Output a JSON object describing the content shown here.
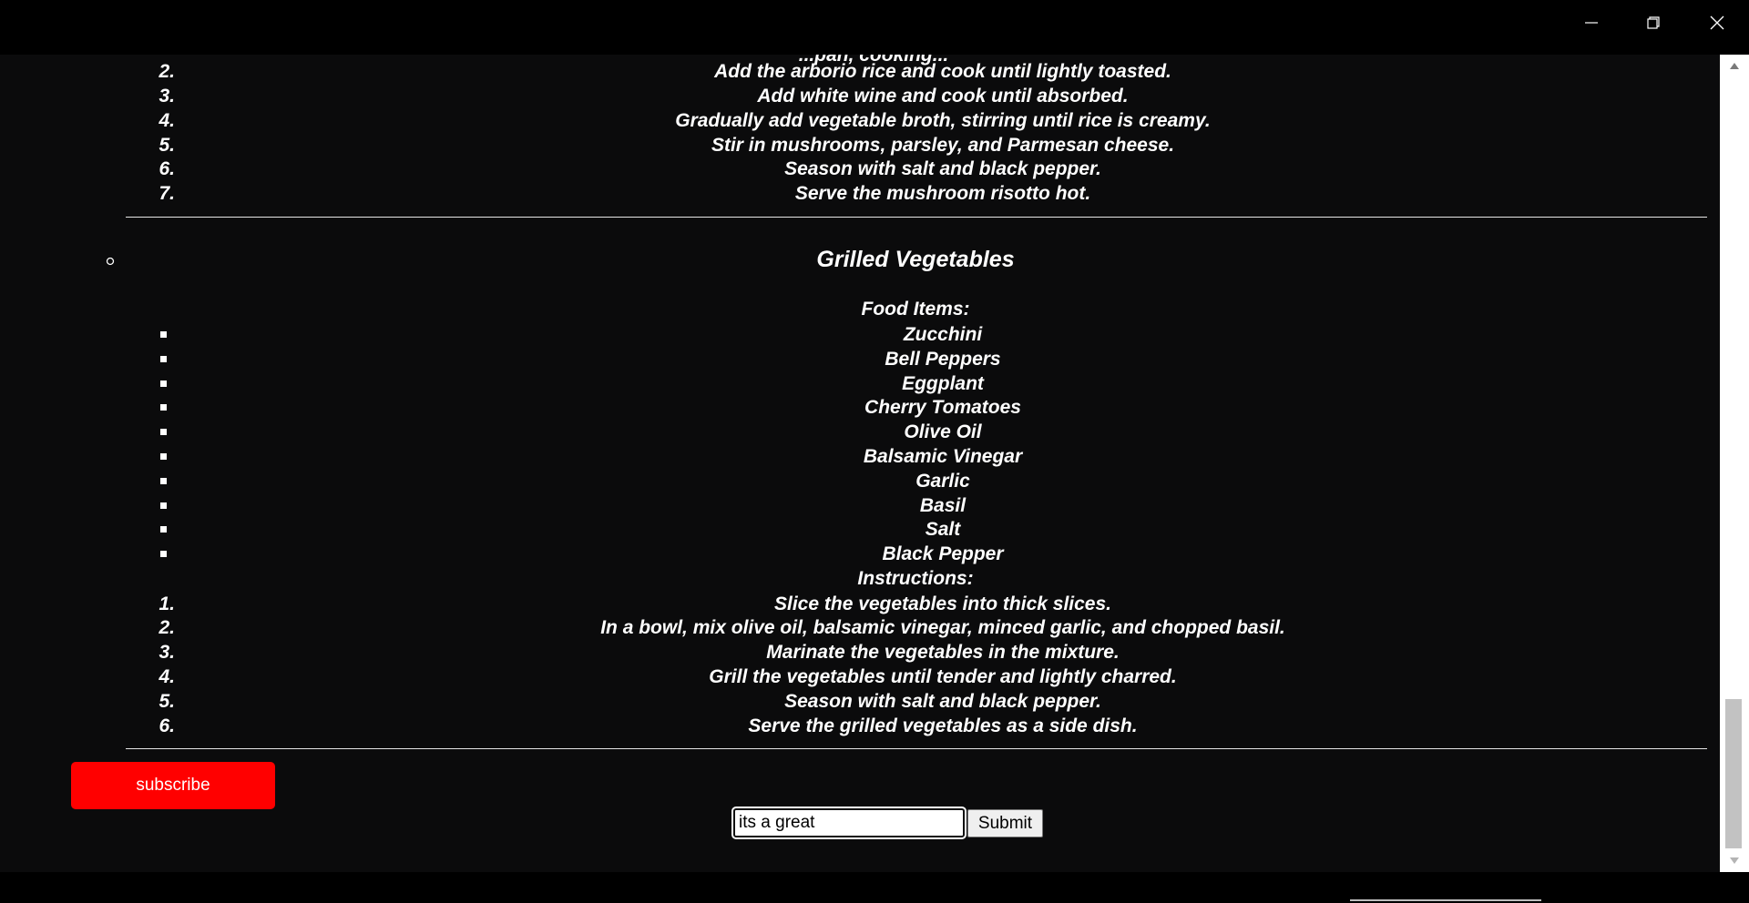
{
  "window": {
    "minimize_icon": "minimize-icon",
    "maximize_icon": "restore-icon",
    "close_icon": "close-icon"
  },
  "previous_recipe": {
    "clipped_step": "...pan, cooking...",
    "steps": [
      {
        "num": "2.",
        "text": "Add the arborio rice and cook until lightly toasted."
      },
      {
        "num": "3.",
        "text": "Add white wine and cook until absorbed."
      },
      {
        "num": "4.",
        "text": "Gradually add vegetable broth, stirring until rice is creamy."
      },
      {
        "num": "5.",
        "text": "Stir in mushrooms, parsley, and Parmesan cheese."
      },
      {
        "num": "6.",
        "text": "Season with salt and black pepper."
      },
      {
        "num": "7.",
        "text": "Serve the mushroom risotto hot."
      }
    ]
  },
  "recipe": {
    "title": "Grilled Vegetables",
    "food_items_label": "Food Items:",
    "food_items": [
      "Zucchini",
      "Bell Peppers",
      "Eggplant",
      "Cherry Tomatoes",
      "Olive Oil",
      "Balsamic Vinegar",
      "Garlic",
      "Basil",
      "Salt",
      "Black Pepper"
    ],
    "instructions_label": "Instructions:",
    "steps": [
      {
        "num": "1.",
        "text": "Slice the vegetables into thick slices."
      },
      {
        "num": "2.",
        "text": "In a bowl, mix olive oil, balsamic vinegar, minced garlic, and chopped basil."
      },
      {
        "num": "3.",
        "text": "Marinate the vegetables in the mixture."
      },
      {
        "num": "4.",
        "text": "Grill the vegetables until tender and lightly charred."
      },
      {
        "num": "5.",
        "text": "Season with salt and black pepper."
      },
      {
        "num": "6.",
        "text": "Serve the grilled vegetables as a side dish."
      }
    ]
  },
  "subscribe": {
    "label": "subscribe",
    "color": "#ff0000"
  },
  "comment_form": {
    "value": "its a great ",
    "submit_label": "Submit"
  }
}
